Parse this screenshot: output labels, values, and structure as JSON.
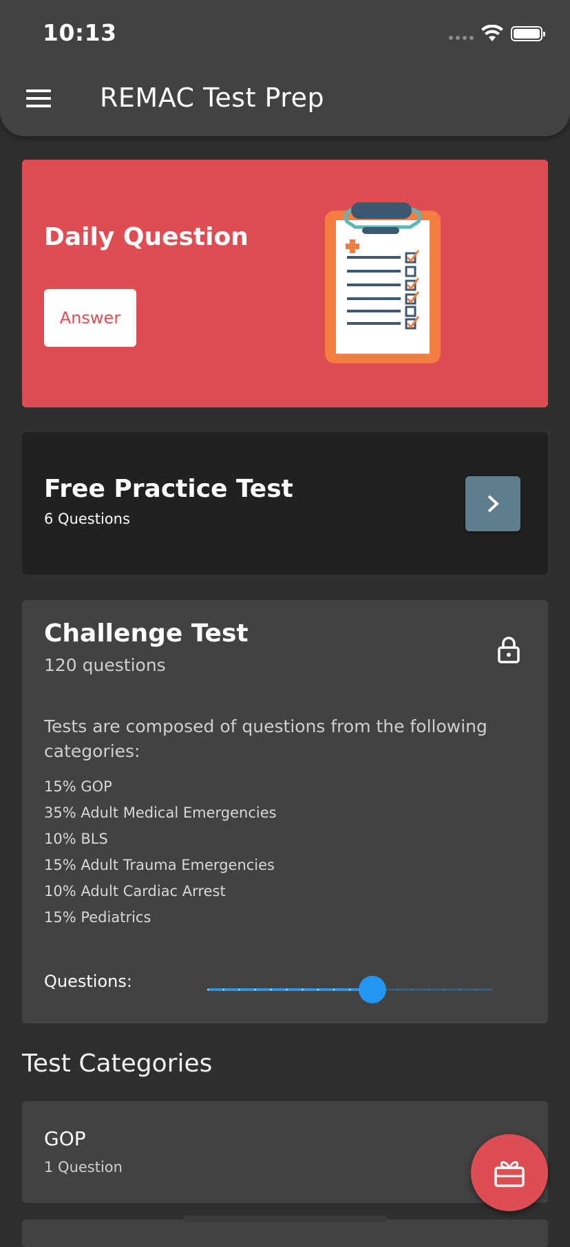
{
  "status_bar": {
    "time": "10:13"
  },
  "app_bar": {
    "title": "REMAC Test Prep",
    "menu_icon": "hamburger-menu-icon"
  },
  "daily_question": {
    "title": "Daily Question",
    "button_label": "Answer",
    "accent_color": "#df4d52",
    "illustration": "clipboard-checklist-icon"
  },
  "free_practice": {
    "title": "Free Practice Test",
    "subtitle": "6 Questions",
    "arrow_icon": "chevron-right-icon"
  },
  "challenge_test": {
    "title": "Challenge Test",
    "subtitle": "120 questions",
    "lock_icon": "lock-icon",
    "description": "Tests are composed of questions from the following categories:",
    "categories": [
      "15% GOP",
      "35% Adult Medical Emergencies",
      "10% BLS",
      "15% Adult Trauma Emergencies",
      "10% Adult Cardiac Arrest",
      "15% Pediatrics"
    ],
    "slider_label": "Questions:",
    "slider_fraction": 0.58,
    "slider_color": "#2196f3"
  },
  "test_categories": {
    "heading": "Test Categories",
    "items": [
      {
        "title": "GOP",
        "subtitle": "1 Question"
      }
    ]
  },
  "fab": {
    "icon": "gift-icon"
  }
}
